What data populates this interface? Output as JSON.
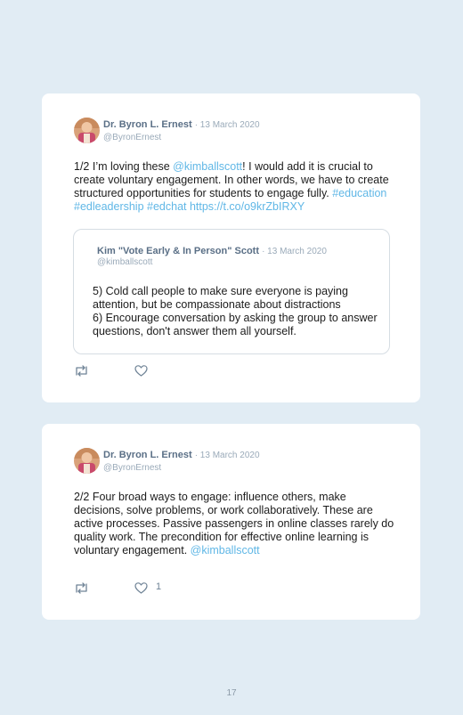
{
  "tweets": [
    {
      "author": "Dr. Byron L. Ernest",
      "date": "· 13 March 2020",
      "handle": "@ByronErnest",
      "text": [
        {
          "t": "1/2 I’m loving these "
        },
        {
          "t": "@kimballscott",
          "link": true
        },
        {
          "t": "! I would add it is crucial to create voluntary engagement. In other words, we have to create structured opportunities for students to engage fully. "
        },
        {
          "t": "#education #edleadership #edchat https://t.co/o9krZbIRXY",
          "link": true
        }
      ],
      "quote": {
        "author": "Kim \"Vote Early & In Person\" Scott",
        "date": "· 13 March 2020",
        "handle": "@kimballscott",
        "line1": "5) Cold call people to make sure everyone is paying attention, but be compassionate about distractions",
        "line2": "6) Encourage conversation by asking the group to answer questions, don't answer them all yourself."
      },
      "likes": ""
    },
    {
      "author": "Dr. Byron L. Ernest",
      "date": "· 13 March 2020",
      "handle": "@ByronErnest",
      "text": [
        {
          "t": "2/2 Four broad ways to engage: influence others, make decisions, solve problems, or work collaboratively. These are active processes. Passive passengers in online classes rarely do quality work. The precondition for effective online learning is voluntary engagement. "
        },
        {
          "t": "@kimballscott",
          "link": true
        }
      ],
      "likes": "1"
    }
  ],
  "page_number": "17",
  "colors": {
    "background": "#e1ecf4",
    "card": "#ffffff",
    "link": "#60b7e6",
    "name": "#5a6f86",
    "muted": "#9aaab9"
  },
  "icons": {
    "retweet": "retweet-icon",
    "like": "heart-icon",
    "avatar": "avatar-photo"
  }
}
